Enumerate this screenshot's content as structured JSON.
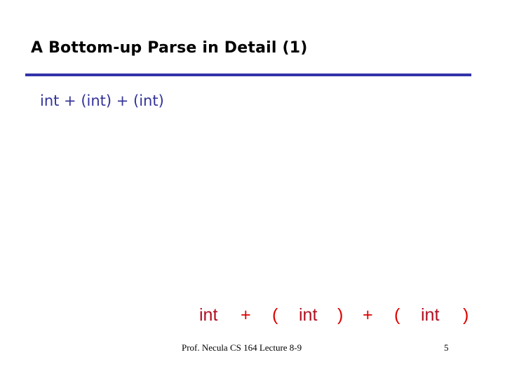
{
  "slide": {
    "title": "A Bottom-up Parse in Detail (1)",
    "subtitle": "int + (int) + (int)",
    "tokens": [
      {
        "text": "int",
        "kind": "int"
      },
      {
        "text": "+",
        "kind": "sym"
      },
      {
        "text": "(",
        "kind": "sym"
      },
      {
        "text": "int",
        "kind": "int"
      },
      {
        "text": ")",
        "kind": "sym"
      },
      {
        "text": "+",
        "kind": "sym"
      },
      {
        "text": "(",
        "kind": "sym"
      },
      {
        "text": "int",
        "kind": "int"
      },
      {
        "text": ")",
        "kind": "sym"
      }
    ],
    "colors": {
      "rule": "#3333aa",
      "subtitle": "#333399",
      "token_int": "#b01020",
      "token_sym": "#dd0000"
    },
    "footer": {
      "text": "Prof. Necula  CS 164  Lecture 8-9",
      "page": "5"
    }
  }
}
